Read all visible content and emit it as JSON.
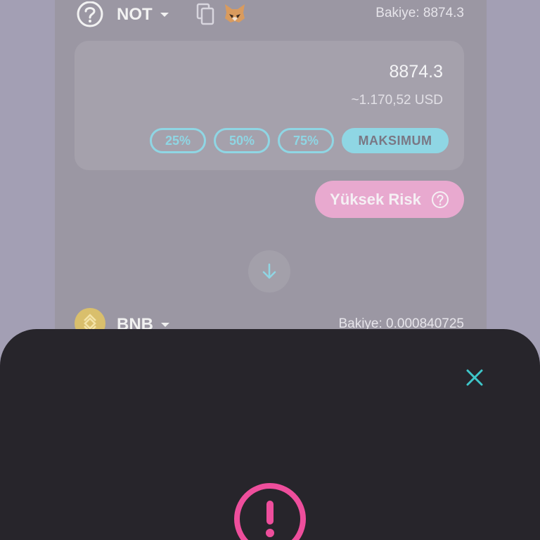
{
  "header": {
    "token": "NOT",
    "balance": "Bakiye: 8874.3"
  },
  "input": {
    "amount": "8874.3",
    "usd": "~1.170,52 USD",
    "percent_buttons": [
      "25%",
      "50%",
      "75%",
      "MAKSIMUM"
    ]
  },
  "risk": {
    "label": "Yüksek Risk"
  },
  "output": {
    "token": "BNB",
    "balance": "Bakiye: 0.000840725"
  },
  "colors": {
    "accent": "#8fd6e4",
    "risk": "#e8a9cf",
    "sheet": "#27252b",
    "close": "#3ec6c9",
    "warning": "#ee4e9c"
  },
  "icons": [
    "help-icon",
    "chevron-down-icon",
    "copy-icon",
    "metamask-fox-icon",
    "arrow-down-icon",
    "bnb-logo-icon",
    "close-icon",
    "warning-icon"
  ]
}
